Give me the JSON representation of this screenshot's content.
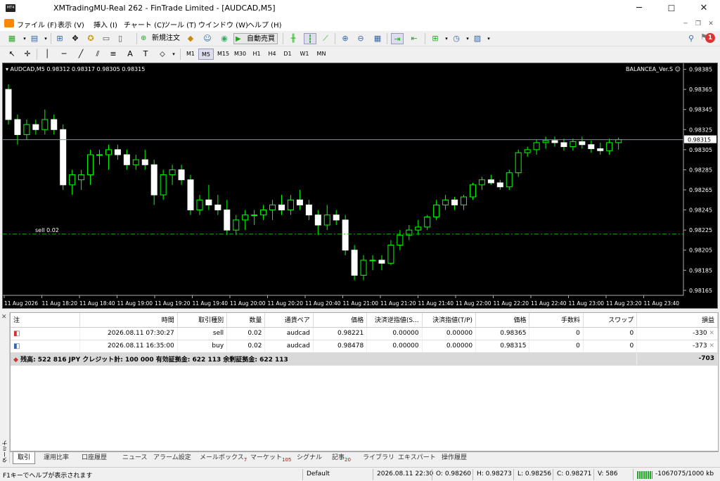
{
  "window": {
    "title": "XMTradingMU-Real 262 - FinTrade Limited - [AUDCAD,M5]",
    "app_icon_text": "MT4",
    "controls": [
      "─",
      "☐",
      "✕"
    ]
  },
  "menu": [
    "ファイル (F)",
    "表示 (V)",
    "挿入 (I)",
    "チャート (C)",
    "ツール (T)",
    "ウインドウ (W)",
    "ヘルプ (H)"
  ],
  "notification_count": "1",
  "toolbar": {
    "new_order": "新規注文",
    "auto_trading": "自動売買"
  },
  "timeframes": [
    "M1",
    "M5",
    "M15",
    "M30",
    "H1",
    "H4",
    "D1",
    "W1",
    "MN"
  ],
  "timeframe_active": "M5",
  "chart_header": {
    "symbol_info": "AUDCAD,M5  0.98312 0.98317 0.98305 0.98315",
    "ea_label": "BALANCEA_Ver.S ☺",
    "current_price": "0.98315",
    "sell_line_label": "sell 0.02"
  },
  "chart_data": {
    "type": "candlestick",
    "price_axis": [
      "0.98385",
      "0.98365",
      "0.98345",
      "0.98325",
      "0.98305",
      "0.98285",
      "0.98265",
      "0.98245",
      "0.98225",
      "0.98205",
      "0.98185",
      "0.98165"
    ],
    "time_axis": [
      "11 Aug 2026",
      "11 Aug 18:20",
      "11 Aug 18:40",
      "11 Aug 19:00",
      "11 Aug 19:20",
      "11 Aug 19:40",
      "11 Aug 20:00",
      "11 Aug 20:20",
      "11 Aug 20:40",
      "11 Aug 21:00",
      "11 Aug 21:20",
      "11 Aug 21:40",
      "11 Aug 22:00",
      "11 Aug 22:20",
      "11 Aug 22:40",
      "11 Aug 23:00",
      "11 Aug 23:20",
      "11 Aug 23:40"
    ],
    "sell_level": 0.98221,
    "bid_level": 0.98315,
    "ylim": [
      0.9816,
      0.98391
    ],
    "candles": [
      [
        0.98365,
        0.9837,
        0.9833,
        0.98335
      ],
      [
        0.98335,
        0.9834,
        0.9831,
        0.9832
      ],
      [
        0.9832,
        0.98335,
        0.98315,
        0.9833
      ],
      [
        0.9833,
        0.98335,
        0.9832,
        0.98325
      ],
      [
        0.98325,
        0.98345,
        0.9832,
        0.98335
      ],
      [
        0.98335,
        0.9834,
        0.9832,
        0.98325
      ],
      [
        0.98325,
        0.9833,
        0.98265,
        0.9827
      ],
      [
        0.9827,
        0.98285,
        0.9826,
        0.9828
      ],
      [
        0.98275,
        0.98285,
        0.98265,
        0.9828
      ],
      [
        0.9828,
        0.98305,
        0.9827,
        0.983
      ],
      [
        0.983,
        0.98305,
        0.9829,
        0.983
      ],
      [
        0.983,
        0.9831,
        0.98285,
        0.98305
      ],
      [
        0.98305,
        0.9831,
        0.98295,
        0.983
      ],
      [
        0.983,
        0.98305,
        0.98285,
        0.9829
      ],
      [
        0.9829,
        0.983,
        0.98285,
        0.98295
      ],
      [
        0.98295,
        0.98305,
        0.98285,
        0.9829
      ],
      [
        0.9829,
        0.98295,
        0.9825,
        0.9826
      ],
      [
        0.9826,
        0.98285,
        0.98255,
        0.9828
      ],
      [
        0.9828,
        0.9829,
        0.9827,
        0.98285
      ],
      [
        0.98285,
        0.9829,
        0.9827,
        0.98275
      ],
      [
        0.98275,
        0.9828,
        0.9824,
        0.98245
      ],
      [
        0.98245,
        0.9826,
        0.9824,
        0.98255
      ],
      [
        0.98255,
        0.9827,
        0.98245,
        0.9825
      ],
      [
        0.9825,
        0.9826,
        0.9824,
        0.98245
      ],
      [
        0.98245,
        0.98255,
        0.9822,
        0.98225
      ],
      [
        0.98225,
        0.9824,
        0.9822,
        0.98235
      ],
      [
        0.98235,
        0.98245,
        0.98225,
        0.9824
      ],
      [
        0.9824,
        0.98245,
        0.9823,
        0.9824
      ],
      [
        0.9824,
        0.9825,
        0.98235,
        0.98245
      ],
      [
        0.98245,
        0.98255,
        0.98235,
        0.9825
      ],
      [
        0.9825,
        0.9826,
        0.9824,
        0.98245
      ],
      [
        0.98245,
        0.9826,
        0.9824,
        0.98255
      ],
      [
        0.98255,
        0.98265,
        0.98245,
        0.9825
      ],
      [
        0.9825,
        0.98255,
        0.98235,
        0.9824
      ],
      [
        0.9824,
        0.98245,
        0.9822,
        0.9823
      ],
      [
        0.9823,
        0.9825,
        0.98225,
        0.9824
      ],
      [
        0.9824,
        0.98245,
        0.9823,
        0.98235
      ],
      [
        0.98235,
        0.9824,
        0.982,
        0.98205
      ],
      [
        0.98205,
        0.9821,
        0.98175,
        0.9818
      ],
      [
        0.9818,
        0.982,
        0.98175,
        0.98195
      ],
      [
        0.98195,
        0.982,
        0.98185,
        0.98195
      ],
      [
        0.98195,
        0.982,
        0.98185,
        0.98192
      ],
      [
        0.98192,
        0.98215,
        0.9819,
        0.9821
      ],
      [
        0.9821,
        0.98225,
        0.98205,
        0.9822
      ],
      [
        0.9822,
        0.9823,
        0.98215,
        0.98225
      ],
      [
        0.98225,
        0.98235,
        0.9822,
        0.98228
      ],
      [
        0.98228,
        0.9824,
        0.98225,
        0.98238
      ],
      [
        0.98238,
        0.98255,
        0.98235,
        0.9825
      ],
      [
        0.9825,
        0.9826,
        0.98245,
        0.98255
      ],
      [
        0.98255,
        0.98258,
        0.98245,
        0.9825
      ],
      [
        0.9825,
        0.9826,
        0.98245,
        0.98258
      ],
      [
        0.98258,
        0.98272,
        0.98255,
        0.9827
      ],
      [
        0.9827,
        0.98278,
        0.98265,
        0.98275
      ],
      [
        0.98275,
        0.9828,
        0.9827,
        0.98272
      ],
      [
        0.98272,
        0.98275,
        0.98265,
        0.98268
      ],
      [
        0.98268,
        0.98285,
        0.98265,
        0.98282
      ],
      [
        0.98282,
        0.98305,
        0.98278,
        0.98302
      ],
      [
        0.98302,
        0.98308,
        0.98298,
        0.98305
      ],
      [
        0.98305,
        0.98315,
        0.983,
        0.98312
      ],
      [
        0.98312,
        0.98318,
        0.98306,
        0.98314
      ],
      [
        0.98314,
        0.98318,
        0.98308,
        0.98312
      ],
      [
        0.98312,
        0.98316,
        0.98304,
        0.98308
      ],
      [
        0.98308,
        0.98316,
        0.98304,
        0.98313
      ],
      [
        0.98313,
        0.98318,
        0.98306,
        0.9831
      ],
      [
        0.9831,
        0.98314,
        0.98302,
        0.98306
      ],
      [
        0.98306,
        0.98312,
        0.983,
        0.98304
      ],
      [
        0.98304,
        0.98316,
        0.983,
        0.98312
      ],
      [
        0.98312,
        0.98317,
        0.98305,
        0.98315
      ]
    ]
  },
  "orders": {
    "headers": [
      "注",
      "時間",
      "取引種別",
      "数量",
      "通貨ペア",
      "価格",
      "決済逆指値(S...",
      "決済指値(T/P)",
      "価格",
      "手数料",
      "スワップ",
      "損益"
    ],
    "rows": [
      {
        "time": "2026.08.11 07:30:27",
        "type": "sell",
        "size": "0.02",
        "symbol": "audcad",
        "price": "0.98221",
        "sl": "0.00000",
        "tp": "0.00000",
        "cur": "0.98365",
        "commission": "0",
        "swap": "0",
        "profit": "-330"
      },
      {
        "time": "2026.08.11 16:35:00",
        "type": "buy",
        "size": "0.02",
        "symbol": "audcad",
        "price": "0.98478",
        "sl": "0.00000",
        "tp": "0.00000",
        "cur": "0.98315",
        "commission": "0",
        "swap": "0",
        "profit": "-373"
      }
    ],
    "summary": "残高: 522 816 JPY  クレジット計: 100 000  有効証拠金: 622 113  余剰証拠金: 622 113",
    "total": "-703"
  },
  "terminal_label": "ターミナル",
  "tabs": [
    {
      "label": "取引",
      "badge": ""
    },
    {
      "label": "運用比率",
      "badge": ""
    },
    {
      "label": "口座履歴",
      "badge": ""
    },
    {
      "label": "ニュース",
      "badge": ""
    },
    {
      "label": "アラーム設定",
      "badge": ""
    },
    {
      "label": "メールボックス",
      "badge": "7"
    },
    {
      "label": "マーケット",
      "badge": "105"
    },
    {
      "label": "シグナル",
      "badge": ""
    },
    {
      "label": "記事",
      "badge": "20"
    },
    {
      "label": "ライブラリ",
      "badge": ""
    },
    {
      "label": "エキスパート",
      "badge": ""
    },
    {
      "label": "操作履歴",
      "badge": ""
    }
  ],
  "status": {
    "help": "F1キーでヘルプが表示されます",
    "profile": "Default",
    "datetime": "2026.08.11 22:30",
    "open": "O: 0.98260",
    "high": "H: 0.98273",
    "low": "L: 0.98256",
    "close": "C: 0.98271",
    "volume": "V: 586",
    "traffic": "-1067075/1000 kb"
  },
  "colors": {
    "chart_bg": "#000000",
    "bull": "#00ff00",
    "bear_fill": "#ffffff",
    "sell_line": "#00c800",
    "bid_line": "#8090a0"
  }
}
